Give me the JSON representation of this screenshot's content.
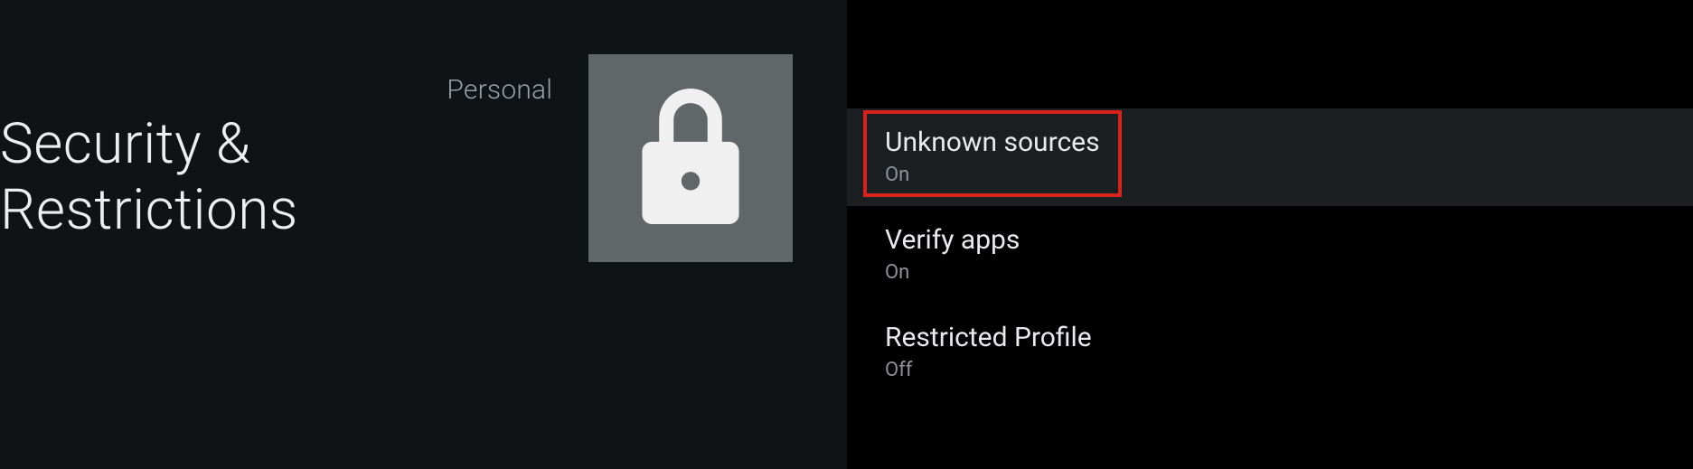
{
  "header": {
    "category": "Personal",
    "title": "Security & Restrictions",
    "icon": "lock-icon"
  },
  "settings": {
    "items": [
      {
        "title": "Unknown sources",
        "value": "On",
        "focused": true,
        "highlighted": true
      },
      {
        "title": "Verify apps",
        "value": "On",
        "focused": false,
        "highlighted": false
      },
      {
        "title": "Restricted Profile",
        "value": "Off",
        "focused": false,
        "highlighted": false
      }
    ]
  },
  "colors": {
    "highlight_border": "#d7221e",
    "background_left": "#0f1315",
    "background_right": "#000000",
    "icon_tile": "#616668"
  }
}
